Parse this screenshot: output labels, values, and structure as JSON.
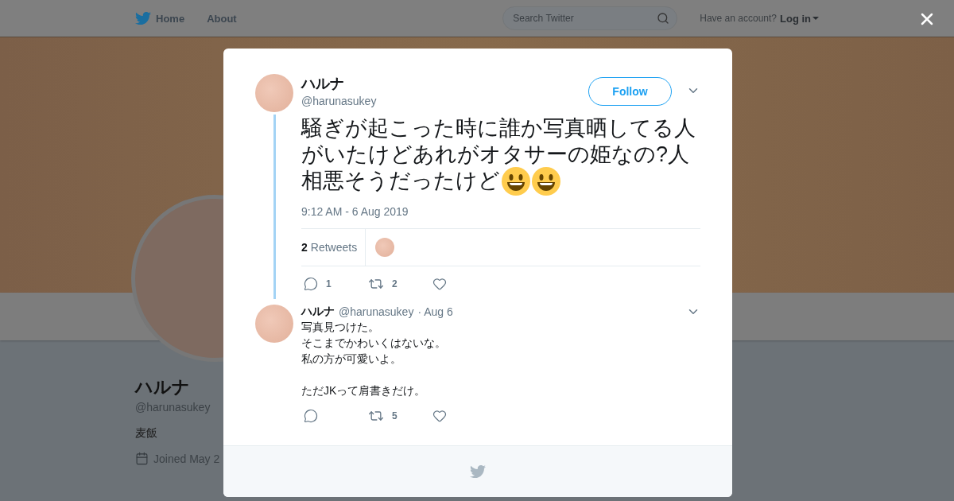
{
  "nav": {
    "items": [
      {
        "label": "Home",
        "kind": "logo"
      },
      {
        "label": "About",
        "kind": "link"
      }
    ],
    "search": {
      "placeholder": "Search Twitter"
    },
    "account_prompt": "Have an account?",
    "login": "Log in"
  },
  "profile": {
    "name": "ハルナ",
    "handle": "@harunasukey",
    "bio": "麦飯",
    "joined": "Joined May 2"
  },
  "tweet": {
    "name": "ハルナ",
    "handle": "@harunasukey",
    "follow": "Follow",
    "text_lines": [
      "騒ぎが起こった時に誰か写真晒してる人",
      "がいたけどあれがオタサーの姫なの?人",
      "相悪そうだったけど"
    ],
    "emojis": [
      {
        "kind": "smiley"
      },
      {
        "kind": "smiley"
      }
    ],
    "time": "9:12 AM - 6 Aug 2019",
    "retweets": {
      "count": "2",
      "label": "Retweets"
    },
    "actions": [
      {
        "kind": "reply",
        "count": "1"
      },
      {
        "kind": "retweet",
        "count": "2"
      },
      {
        "kind": "like"
      }
    ]
  },
  "reply": {
    "name": "ハルナ",
    "handle": "@harunasukey",
    "date": "· Aug 6",
    "paragraphs": [
      [
        "写真見つけた。",
        "そこまでかわいくはないな。",
        "私の方が可愛いよ。"
      ],
      [
        "ただJKって肩書きだけ。"
      ]
    ],
    "actions": [
      {
        "kind": "reply"
      },
      {
        "kind": "retweet",
        "count": "5"
      },
      {
        "kind": "like"
      }
    ]
  }
}
